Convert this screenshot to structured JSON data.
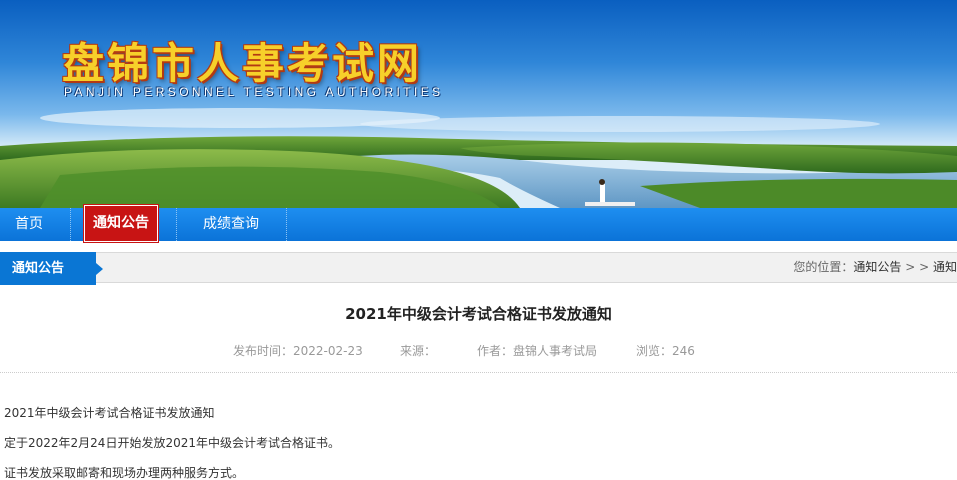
{
  "site": {
    "title": "盘锦市人事考试网",
    "subtitle": "PANJIN PERSONNEL TESTING AUTHORITIES"
  },
  "nav": {
    "items": [
      {
        "label": "首页",
        "active": false
      },
      {
        "label": "通知公告",
        "active": true
      },
      {
        "label": "成绩查询",
        "active": false
      }
    ]
  },
  "section": {
    "tab_label": "通知公告",
    "breadcrumb": {
      "prefix": "您的位置：",
      "crumb1": "通知公告",
      "separator": " > > ",
      "crumb2": "通知"
    }
  },
  "article": {
    "title": "2021年中级会计考试合格证书发放通知",
    "meta": {
      "publish": "发布时间：2022-02-23",
      "source": "来源：",
      "author": "作者：盘锦人事考试局",
      "views": "浏览：246"
    },
    "paragraphs": [
      "2021年中级会计考试合格证书发放通知",
      "定于2022年2月24日开始发放2021年中级会计考试合格证书。",
      "证书发放采取邮寄和现场办理两种服务方式。"
    ]
  },
  "colors": {
    "nav_blue": "#0b73d8",
    "active_red": "#c81414",
    "title_gold": "#f7d02a"
  }
}
